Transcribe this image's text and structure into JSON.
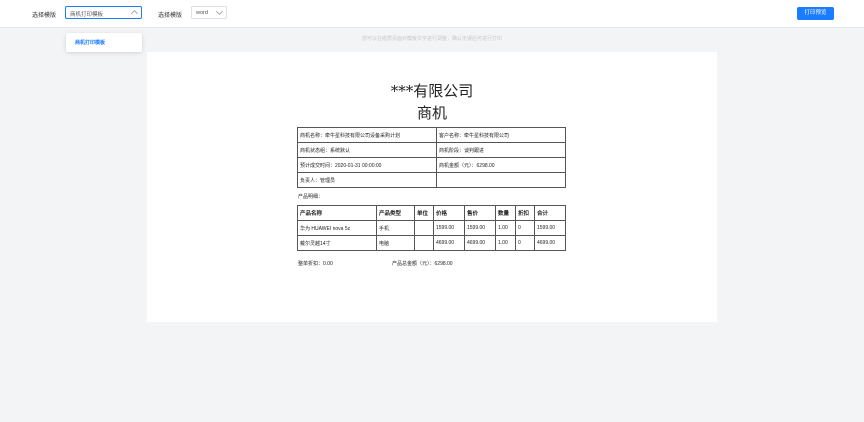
{
  "topbar": {
    "template_label": "选择模版",
    "template_value": "商机打印模板",
    "format_label": "选择模版",
    "format_value": "word",
    "print_button": "打印预览"
  },
  "dropdown": {
    "items": [
      "商机打印模板"
    ]
  },
  "hint": "您可以在纸质页面对模板文字进行调整，确认无误后可进行打印",
  "doc": {
    "company": "***有限公司",
    "title": "商机",
    "info": [
      [
        "商机名称：牵牛星科技有限公司设备采购计划",
        "客户名称：牵牛星科技有限公司"
      ],
      [
        "商机状态组：系统默认",
        "商机阶段：谈判跟进"
      ],
      [
        "预计成交时间：2020-01-31 00:00:00",
        "商机金额（元）：6298.00"
      ],
      [
        "负责人：管理员",
        ""
      ]
    ],
    "products_label": "产品明细：",
    "product_headers": [
      "产品名称",
      "产品类型",
      "单位",
      "价格",
      "售价",
      "数量",
      "折扣",
      "合计"
    ],
    "products": [
      [
        "华为 HUAWEI nova 5z",
        "手机",
        "",
        "1599.00",
        "1599.00",
        "1.00",
        "0",
        "1599.00"
      ],
      [
        "戴尔灵越14寸",
        "电脑",
        "",
        "4699.00",
        "4699.00",
        "1.00",
        "0",
        "4699.00"
      ]
    ],
    "discount": "整单折扣：0.00",
    "total": "产品总金额（元）：6298.00"
  }
}
